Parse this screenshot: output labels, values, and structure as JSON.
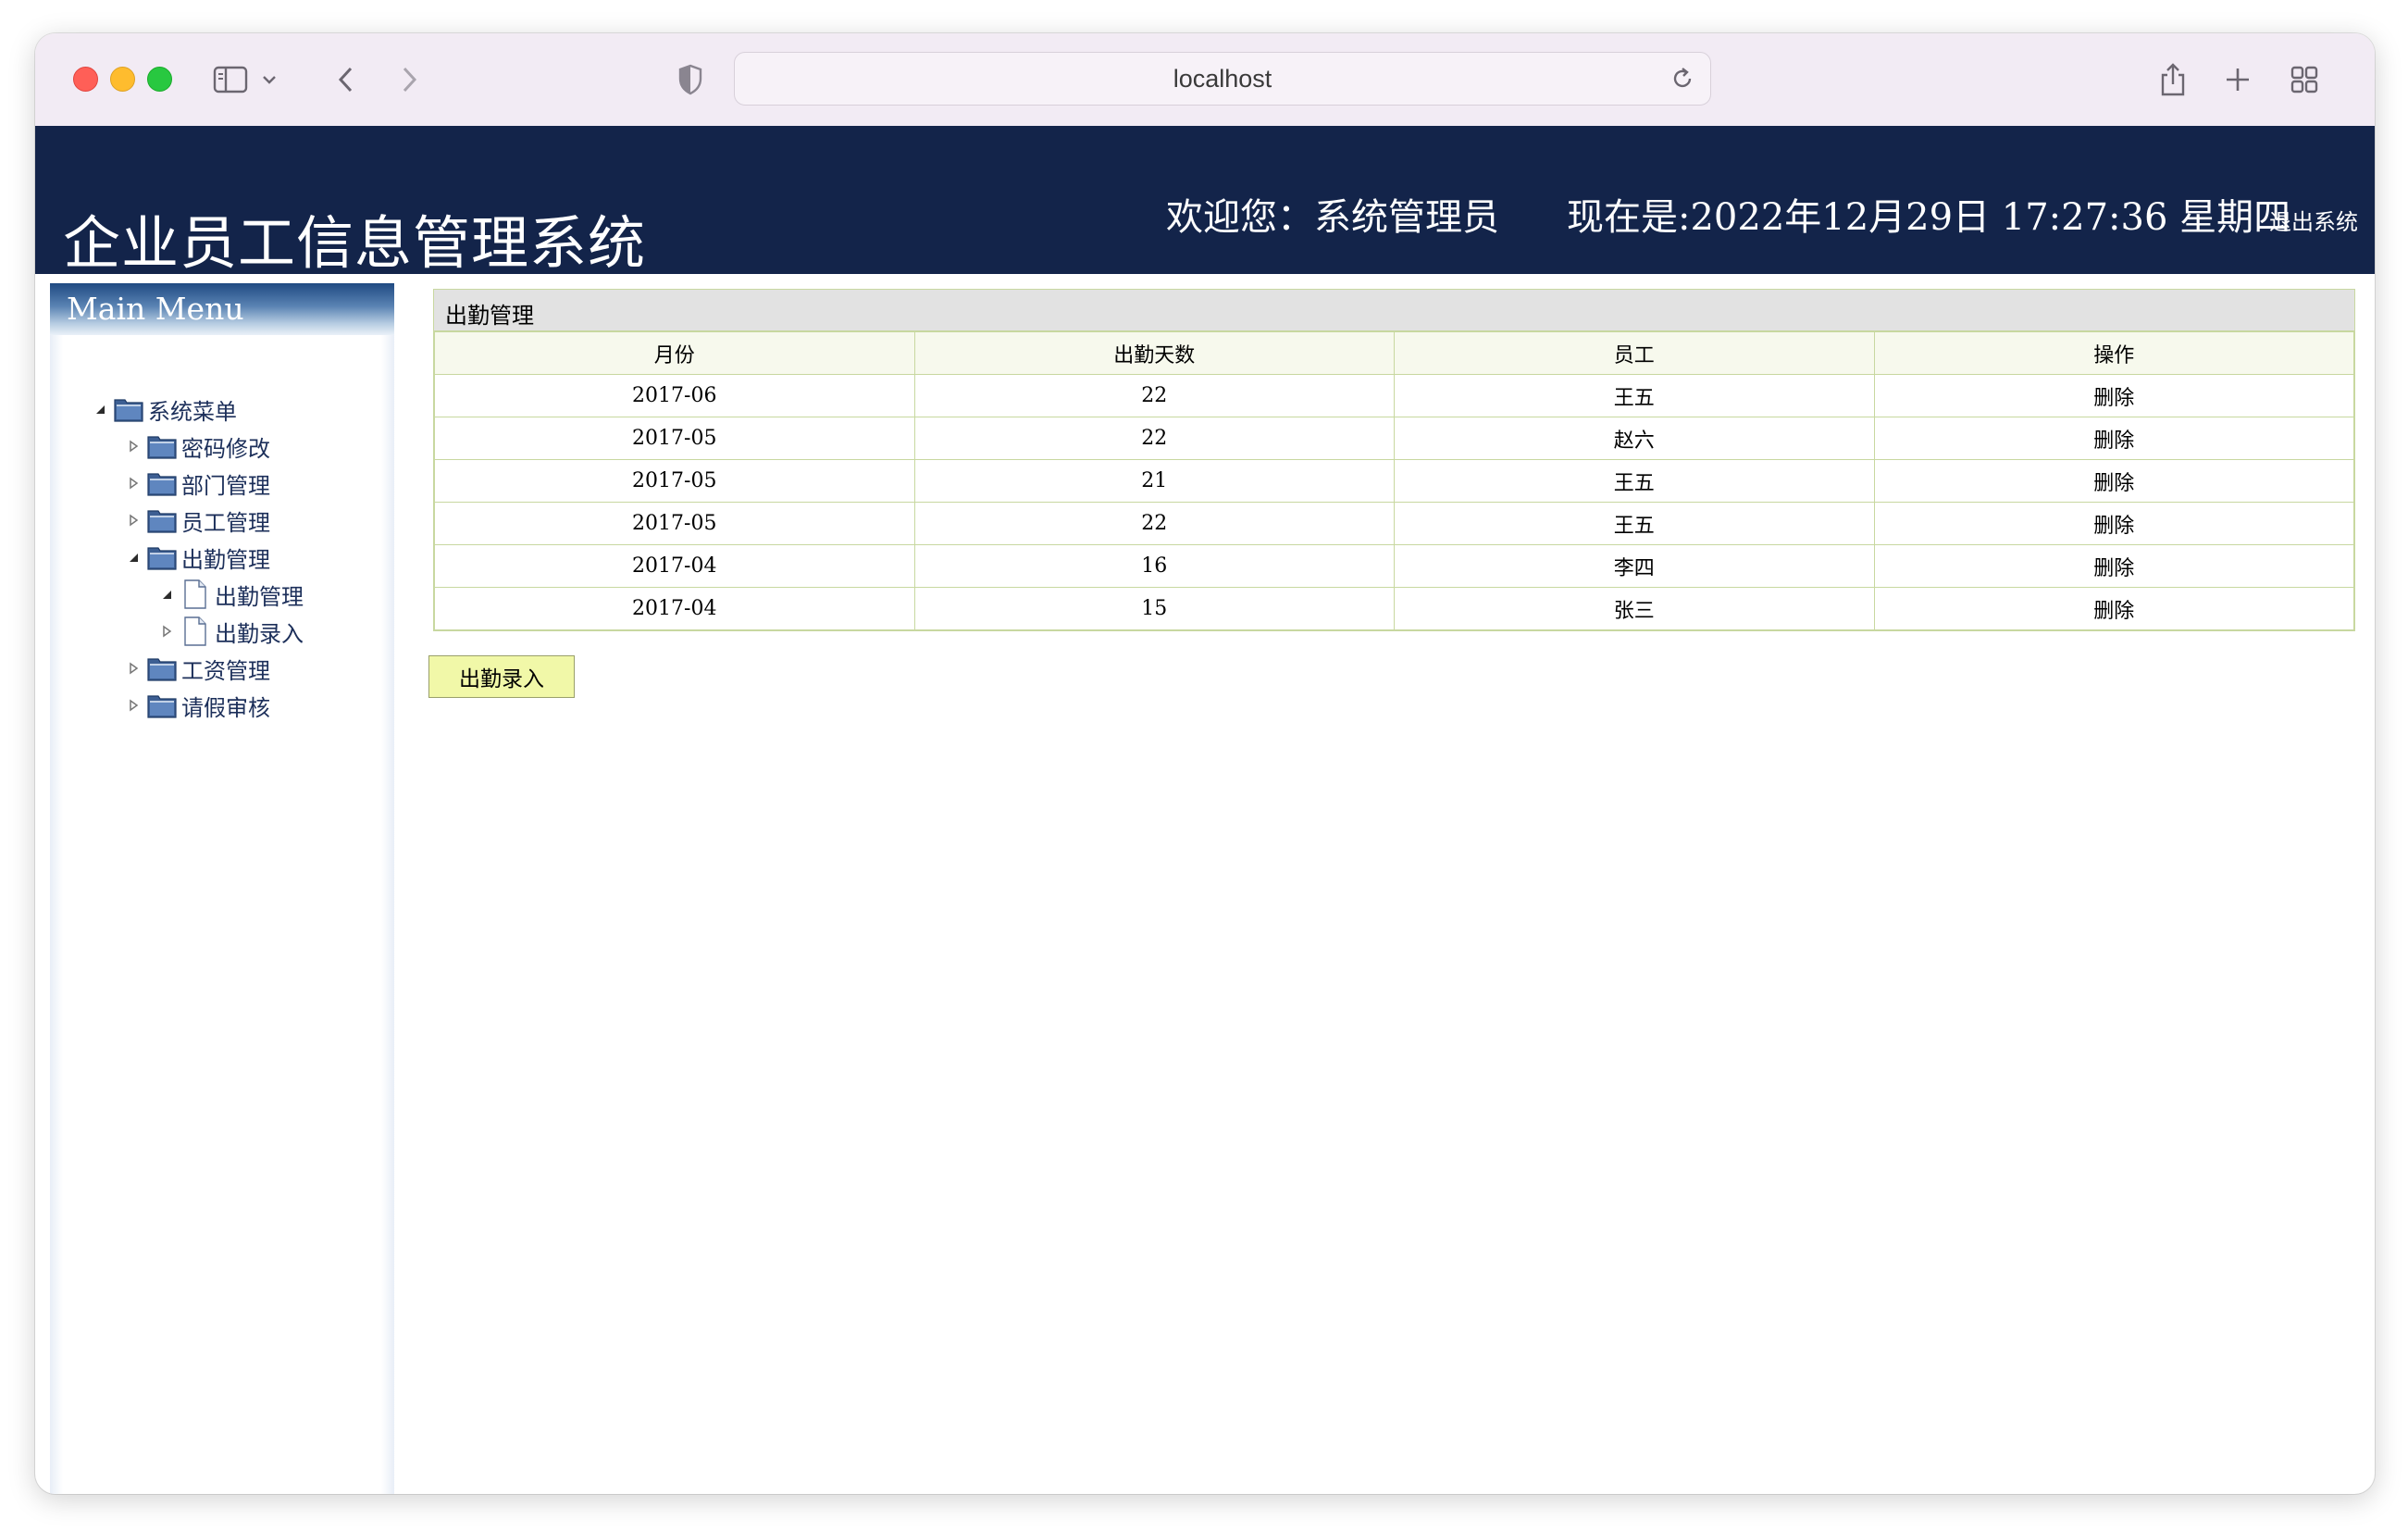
{
  "browser": {
    "url": "localhost"
  },
  "header": {
    "title": "企业员工信息管理系统",
    "welcome": "欢迎您：系统管理员",
    "datetime": "现在是:2022年12月29日 17:27:36 星期四",
    "logout": "退出系统"
  },
  "sidebar": {
    "menu_title": "Main Menu",
    "root": {
      "label": "系统菜单",
      "expanded": true,
      "icon": "folder-icon"
    },
    "items": [
      {
        "label": "密码修改",
        "expanded": false,
        "icon": "folder-icon"
      },
      {
        "label": "部门管理",
        "expanded": false,
        "icon": "folder-icon"
      },
      {
        "label": "员工管理",
        "expanded": false,
        "icon": "folder-icon"
      },
      {
        "label": "出勤管理",
        "expanded": true,
        "icon": "folder-icon",
        "children": [
          {
            "label": "出勤管理",
            "icon": "page-icon"
          },
          {
            "label": "出勤录入",
            "icon": "page-icon"
          }
        ]
      },
      {
        "label": "工资管理",
        "expanded": false,
        "icon": "folder-icon"
      },
      {
        "label": "请假审核",
        "expanded": false,
        "icon": "folder-icon"
      }
    ]
  },
  "main": {
    "panel_title": "出勤管理",
    "columns": [
      "月份",
      "出勤天数",
      "员工",
      "操作"
    ],
    "rows": [
      {
        "month": "2017-06",
        "days": "22",
        "employee": "王五",
        "action": "删除"
      },
      {
        "month": "2017-05",
        "days": "22",
        "employee": "赵六",
        "action": "删除"
      },
      {
        "month": "2017-05",
        "days": "21",
        "employee": "王五",
        "action": "删除"
      },
      {
        "month": "2017-05",
        "days": "22",
        "employee": "王五",
        "action": "删除"
      },
      {
        "month": "2017-04",
        "days": "16",
        "employee": "李四",
        "action": "删除"
      },
      {
        "month": "2017-04",
        "days": "15",
        "employee": "张三",
        "action": "删除"
      }
    ],
    "add_button": "出勤录入"
  },
  "colors": {
    "header_bg": "#13244a",
    "table_border": "#c8d8a0",
    "table_head_bg": "#f7f9ed",
    "button_bg": "#f1f8a8"
  }
}
